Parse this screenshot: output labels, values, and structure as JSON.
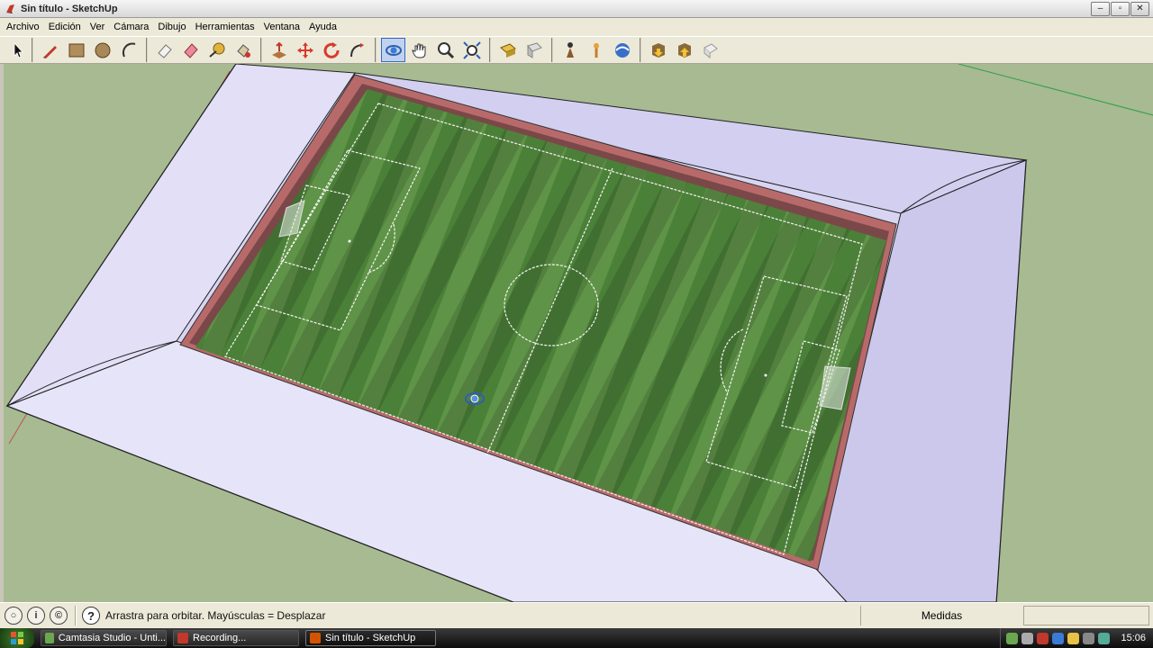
{
  "window": {
    "title": "Sin título - SketchUp"
  },
  "menu": [
    "Archivo",
    "Edición",
    "Ver",
    "Cámara",
    "Dibujo",
    "Herramientas",
    "Ventana",
    "Ayuda"
  ],
  "toolbar": {
    "tools": [
      "select-icon",
      "pencil-icon",
      "rectangle-icon",
      "circle-icon",
      "arc-icon",
      "eraser-icon",
      "paint-bucket-icon",
      "tape-measure-icon",
      "paint-icon",
      "push-pull-icon",
      "move-icon",
      "rotate-icon",
      "follow-me-icon",
      "orbit-icon",
      "pan-icon",
      "zoom-icon",
      "zoom-extents-icon",
      "section-plane-icon",
      "component-icon",
      "walk-icon",
      "position-camera-icon",
      "look-around-icon",
      "get-models-icon",
      "share-model-icon",
      "geo-location-icon"
    ]
  },
  "status": {
    "hint": "Arrastra para orbitar. Mayúsculas = Desplazar",
    "measure_label": "Medidas",
    "measure_value": ""
  },
  "taskbar": {
    "start_label": "",
    "tasks": [
      "Camtasia Studio - Unti...",
      "Recording...",
      "Sin título - SketchUp"
    ],
    "clock": "15:06"
  },
  "colors": {
    "ground": "#a7ba91",
    "stand": "#d8d5f2",
    "pitch_light": "#5f9347",
    "pitch_dark": "#3f7330",
    "ui_face": "#ece9d8"
  }
}
